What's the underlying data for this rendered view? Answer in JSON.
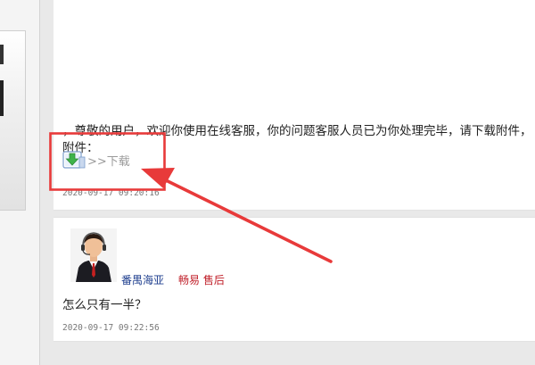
{
  "reply": {
    "message": "，尊敬的用户，欢迎你使用在线客服，你的问题客服人员已为你处理完毕，请下载附件，",
    "attachment_label": "附件：",
    "download_label": ">>下载",
    "timestamp": "2020-09-17 09:20:16"
  },
  "followup": {
    "agent_name": "番禺海亚",
    "agent_dept": "畅易 售后",
    "question": "怎么只有一半？",
    "timestamp": "2020-09-17 09:22:56"
  },
  "icons": {
    "download": "download-arrow-icon",
    "avatar": "agent-avatar"
  },
  "colors": {
    "annotation_red": "#e83a3a",
    "agent_name": "#1f3f8f",
    "agent_dept": "#c0202a"
  }
}
